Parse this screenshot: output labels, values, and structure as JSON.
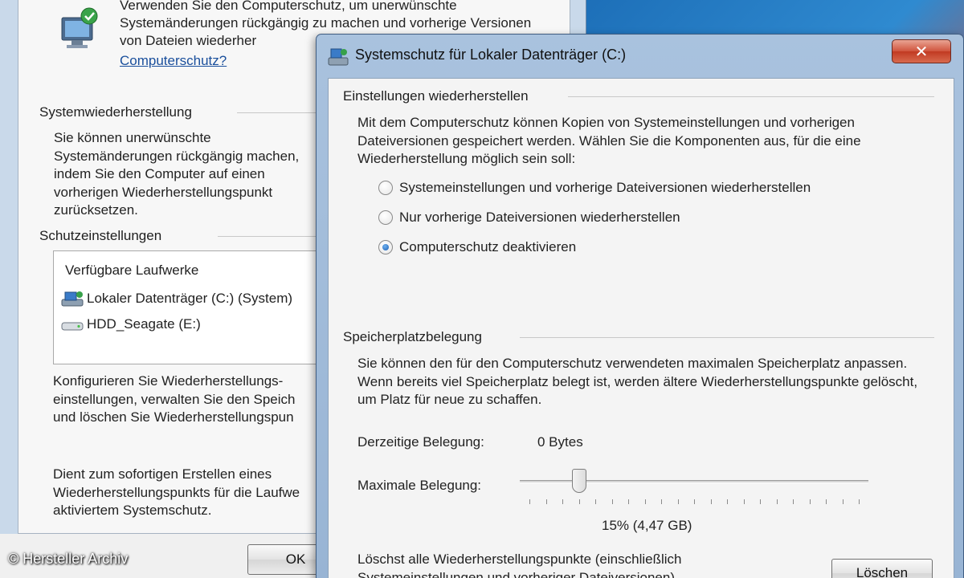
{
  "back_window": {
    "top_text": "Verwenden Sie den Computerschutz, um unerwünschte Systemänderungen rückgängig zu machen und vorherige Versionen von Dateien wiederher",
    "top_link": "Computerschutz?",
    "restore_header": "Systemwiederherstellung",
    "restore_text": "Sie können unerwünschte Systemänderungen rückgängig machen, indem Sie den Computer auf einen vorherigen Wiederherstellungspunkt zurücksetzen.",
    "protection_header": "Schutzeinstellungen",
    "drives_header": "Verfügbare Laufwerke",
    "drives": [
      {
        "label": "Lokaler Datenträger (C:) (System)",
        "icon": "system-drive-icon"
      },
      {
        "label": "HDD_Seagate (E:)",
        "icon": "hard-drive-icon"
      }
    ],
    "configure_text": "Konfigurieren Sie Wiederherstellungs-einstellungen, verwalten Sie den Speich und löschen Sie Wiederherstellungspun",
    "create_text": "Dient zum sofortigen Erstellen eines Wiederherstellungspunkts für die Laufwe aktiviertem Systemschutz.",
    "ok_label": "OK"
  },
  "watermark": "© Hersteller Archiv",
  "dialog": {
    "title": "Systemschutz für Lokaler Datenträger (C:)",
    "close_label": "✕",
    "restore_settings": {
      "header": "Einstellungen wiederherstellen",
      "description": "Mit dem Computerschutz können Kopien von Systemeinstellungen und vorherigen Dateiversionen gespeichert werden. Wählen Sie die Komponenten aus, für die eine Wiederherstellung möglich sein soll:",
      "options": [
        {
          "label": "Systemeinstellungen und vorherige Dateiversionen wiederherstellen",
          "checked": false
        },
        {
          "label": "Nur vorherige Dateiversionen wiederherstellen",
          "checked": false
        },
        {
          "label": "Computerschutz deaktivieren",
          "checked": true
        }
      ]
    },
    "disk_usage": {
      "header": "Speicherplatzbelegung",
      "description": "Sie können den für den Computerschutz verwendeten maximalen Speicherplatz anpassen. Wenn bereits viel Speicherplatz belegt ist, werden ältere Wiederherstellungspunkte gelöscht, um Platz für neue zu schaffen.",
      "current_label": "Derzeitige Belegung:",
      "current_value": "0 Bytes",
      "max_label": "Maximale Belegung:",
      "max_value": "15% (4,47 GB)",
      "slider_fraction": 0.15,
      "delete_text": "Löschst alle Wiederherstellungspunkte (einschließlich Systemeinstellungen und vorheriger Dateiversionen).",
      "delete_label": "Löschen"
    }
  },
  "colors": {
    "link": "#1a4f9c",
    "title_bar": "#a9c2de",
    "close_button": "#c13a22"
  }
}
